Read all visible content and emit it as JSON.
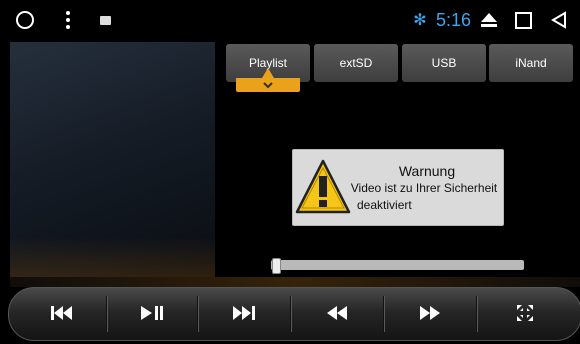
{
  "status_bar": {
    "time": "5:16",
    "icons": [
      "circle-home-icon",
      "overflow-menu-icon",
      "image-notification-icon",
      "bluetooth-icon",
      "eject-icon",
      "recents-square-icon",
      "back-triangle-icon"
    ],
    "accent_color": "#3da5f0"
  },
  "tabs": [
    {
      "label": "Playlist",
      "active": true
    },
    {
      "label": "extSD",
      "active": false
    },
    {
      "label": "USB",
      "active": false
    },
    {
      "label": "iNand",
      "active": false
    }
  ],
  "dialog": {
    "title": "Warnung",
    "line1": "Video ist zu Ihrer Sicherheit",
    "line2": "deaktiviert",
    "icon": "warning-icon"
  },
  "progress": {
    "position": 0
  },
  "controls": [
    "previous-icon",
    "play-pause-icon",
    "next-icon",
    "rewind-icon",
    "fast-forward-icon",
    "fullscreen-icon"
  ],
  "colors": {
    "tab_active_accent": "#e9a21a",
    "dialog_bg": "#dadada"
  }
}
